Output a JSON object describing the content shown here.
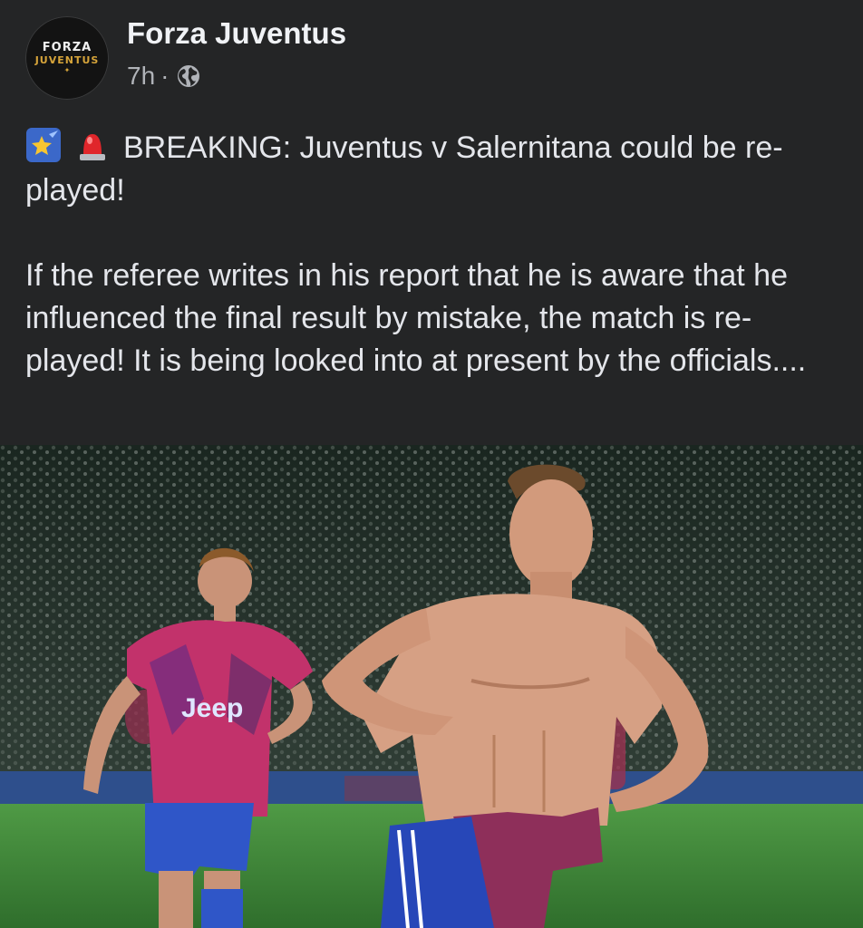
{
  "post": {
    "page_name": "Forza Juventus",
    "avatar_text": {
      "line1": "FORZA",
      "line2": "JUVENTUS"
    },
    "timestamp": "7h",
    "separator": "·",
    "audience_icon": "globe-icon",
    "emojis": [
      "shooting-star-emoji",
      "siren-emoji"
    ],
    "headline": "BREAKING: Juventus v Salernitana could be re-played!",
    "body": "If the referee writes in his report that he is aware that he influenced the final result by mistake, the match is re-played! It is being looked into at present by the officials....",
    "image": {
      "jersey_text": "Jeep"
    }
  },
  "colors": {
    "background": "#242526",
    "text": "#e4e6eb",
    "secondary_text": "#b0b3b8",
    "avatar_gold": "#d6a43a",
    "jersey_pink": "#c2326b",
    "pitch_green": "#3f8a3a"
  }
}
